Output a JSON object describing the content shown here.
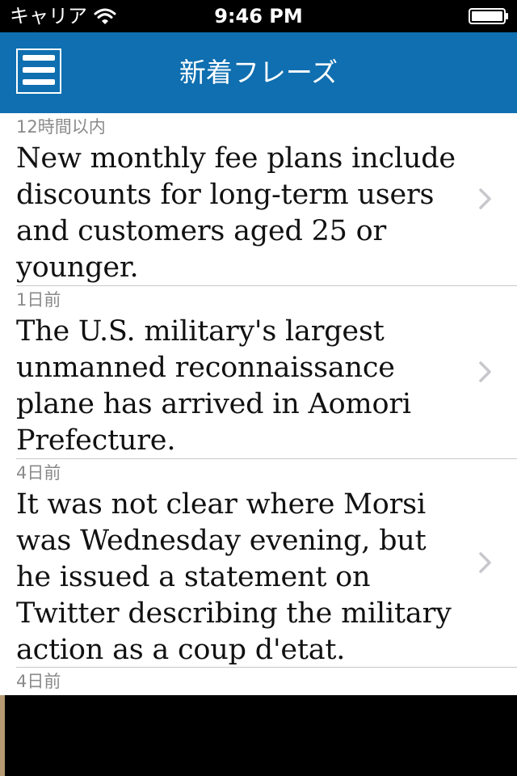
{
  "status_bar": {
    "carrier": "キャリア",
    "time": "9:46 PM",
    "wifi_icon": "wifi-icon",
    "battery_icon": "battery-icon"
  },
  "nav": {
    "title": "新着フレーズ",
    "menu_icon": "hamburger-menu-icon",
    "accent_color": "#0f6fb0"
  },
  "items": [
    {
      "time": "12時間以内",
      "text": "New monthly fee plans include discounts for long-term users and customers aged 25 or younger."
    },
    {
      "time": "1日前",
      "text": "The U.S. military's largest unmanned reconnaissance plane has arrived in Aomori Prefecture."
    },
    {
      "time": "4日前",
      "text": "It was not clear where Morsi was Wednesday evening, but he issued a statement on Twitter describing the military action as a coup d'etat."
    },
    {
      "time": "4日前",
      "text": ""
    }
  ]
}
